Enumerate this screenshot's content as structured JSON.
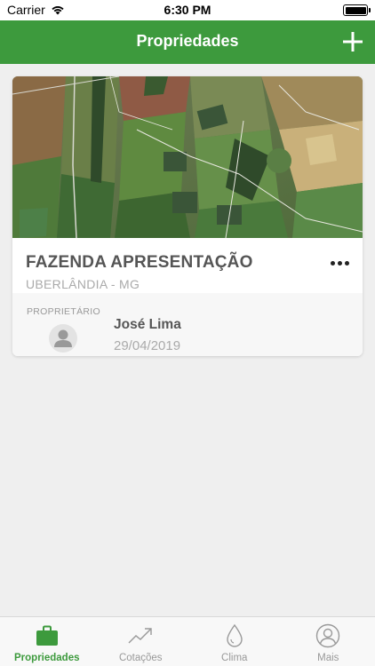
{
  "status_bar": {
    "carrier": "Carrier",
    "time": "6:30 PM"
  },
  "nav": {
    "title": "Propriedades",
    "add_icon": "plus-icon"
  },
  "property": {
    "name": "FAZENDA APRESENTAÇÃO",
    "location": "UBERLÂNDIA - MG",
    "owner_label": "PROPRIETÁRIO",
    "owner_name": "José Lima",
    "date": "29/04/2019"
  },
  "tabs": [
    {
      "label": "Propriedades",
      "icon": "briefcase-icon",
      "active": true
    },
    {
      "label": "Cotações",
      "icon": "trending-up-icon",
      "active": false
    },
    {
      "label": "Clima",
      "icon": "drop-icon",
      "active": false
    },
    {
      "label": "Mais",
      "icon": "user-circle-icon",
      "active": false
    }
  ],
  "colors": {
    "accent": "#3d9a3d",
    "background": "#efefef",
    "tab_inactive": "#999999"
  }
}
